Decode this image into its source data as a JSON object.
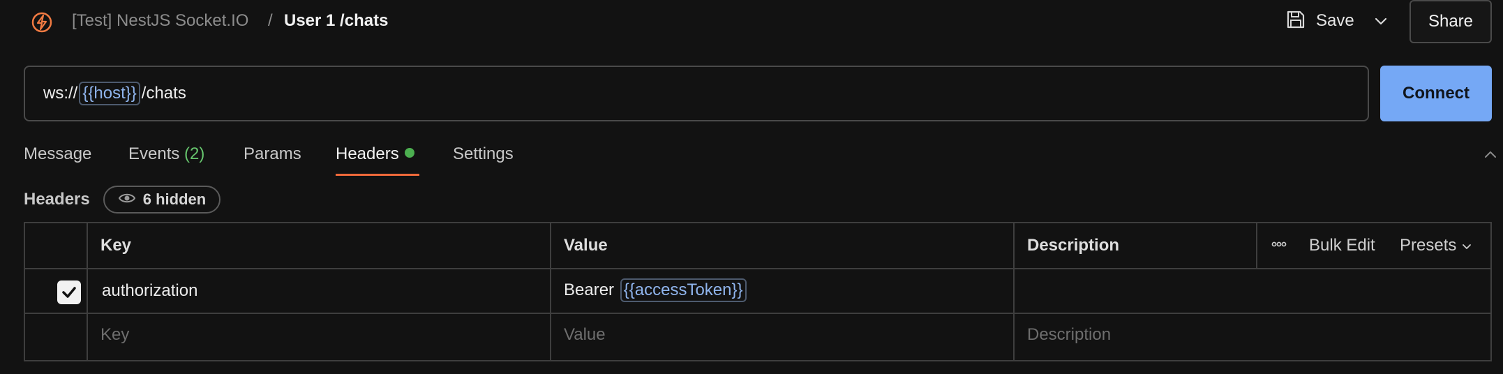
{
  "header": {
    "breadcrumb_parent": "[Test] NestJS Socket.IO",
    "breadcrumb_separator": "/",
    "breadcrumb_current": "User 1 /chats",
    "save_label": "Save",
    "share_label": "Share"
  },
  "url_bar": {
    "prefix": "ws://",
    "variable": "{{host}}",
    "suffix": "/chats",
    "connect_label": "Connect"
  },
  "tabs": {
    "message": "Message",
    "events": "Events",
    "events_count": "(2)",
    "params": "Params",
    "headers": "Headers",
    "settings": "Settings"
  },
  "headers_section": {
    "title": "Headers",
    "hidden_label": "6 hidden"
  },
  "table": {
    "columns": {
      "key": "Key",
      "value": "Value",
      "description": "Description"
    },
    "actions": {
      "bulk_edit": "Bulk Edit",
      "presets": "Presets"
    },
    "rows": [
      {
        "checked": true,
        "key": "authorization",
        "value_prefix": "Bearer",
        "value_variable": "{{accessToken}}",
        "description": ""
      }
    ],
    "new_row": {
      "key_placeholder": "Key",
      "value_placeholder": "Value",
      "description_placeholder": "Description"
    }
  },
  "colors": {
    "accent": "#f06a3a",
    "connect_bg": "#75a8f5",
    "variable_text": "#8fb4ec",
    "status_green": "#4caf50"
  },
  "icons": {
    "logo": "postman-logo-icon",
    "save": "floppy-disk-icon",
    "chevron": "chevron-down-icon",
    "eye": "eye-icon",
    "more": "more-horizontal-icon",
    "collapse": "chevron-up-icon",
    "check": "checkmark-icon"
  }
}
